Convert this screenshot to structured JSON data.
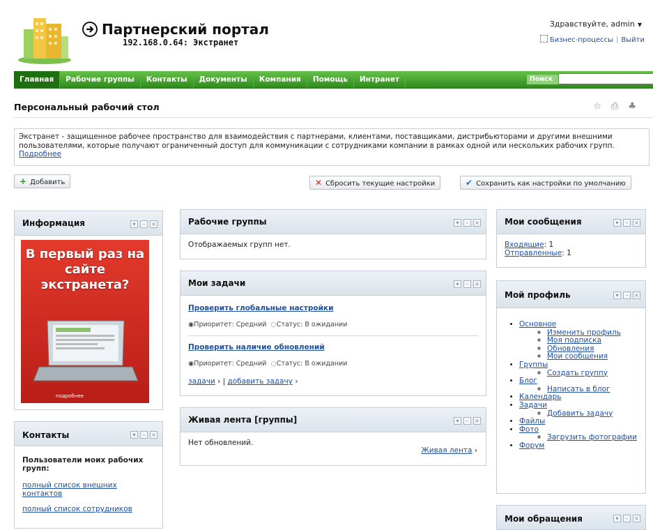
{
  "header": {
    "title": "Партнерский портал",
    "subtitle": "192.168.0.64: Экстранет",
    "greeting": "Здравствуйте, admin",
    "business_processes": "Бизнес-процессы",
    "logout": "Выйти"
  },
  "nav": {
    "items": [
      "Главная",
      "Рабочие группы",
      "Контакты",
      "Документы",
      "Компания",
      "Помощь",
      "Интранет"
    ],
    "search_label": "Поиск",
    "search_value": "",
    "search_btn": "x"
  },
  "page": {
    "title": "Персональный рабочий стол",
    "intro": "Экстранет - защищенное рабочее пространство для взаимодействия с партнерами, клиентами, поставщиками, дистрибьюторами и другими внешними пользователями, которые получают ограниченный доступ для коммуникации с сотрудниками компании в рамках одной или нескольких рабочих групп.",
    "intro_more": "Подробнее"
  },
  "toolbar": {
    "add": "Добавить",
    "reset": "Сбросить текущие настройки",
    "save_default": "Сохранить как настройки по умолчанию"
  },
  "colors": {
    "nav_green": "#2f8b1c",
    "link_blue": "#1f4fa0",
    "ad_red": "#d1261c"
  },
  "gadgets": {
    "info": {
      "title": "Информация",
      "ad_text": "В первый раз на сайте экстранета?",
      "ad_more": "подробнее"
    },
    "contacts": {
      "title": "Контакты",
      "subtitle": "Пользователи моих рабочих групп:",
      "link1": "полный список внешних контактов",
      "link2": "полный список сотрудников"
    },
    "workgroups": {
      "title": "Рабочие группы",
      "text": "Отображаемых групп нет."
    },
    "tasks": {
      "title": "Мои задачи",
      "items": [
        {
          "name": "Проверить глобальные настройки",
          "priority": "Приоритет: Средний",
          "status": "Статус: В ожидании"
        },
        {
          "name": "Проверить наличие обновлений",
          "priority": "Приоритет: Средний",
          "status": "Статус: В ожидании"
        }
      ],
      "link_tasks": "задачи",
      "link_add": "добавить задачу"
    },
    "livefeed": {
      "title": "Живая лента [группы]",
      "text": "Нет обновлений.",
      "link": "Живая лента"
    },
    "messages": {
      "title": "Мои сообщения",
      "inbox_label": "Входящие",
      "inbox_count": ": 1",
      "sent_label": "Отправленные",
      "sent_count": ": 1"
    },
    "profile": {
      "title": "Мой профиль",
      "basic": "Основное",
      "basic_sub": [
        "Изменить профиль",
        "Моя подписка",
        "Обновления",
        "Мои сообщения"
      ],
      "groups": "Группы",
      "groups_sub": [
        "Создать группу"
      ],
      "blog": "Блог",
      "blog_sub": [
        "Написать в блог"
      ],
      "calendar": "Календарь",
      "tasks": "Задачи",
      "tasks_sub": [
        "Добавить задачу"
      ],
      "files": "Файлы",
      "photo": "Фото",
      "photo_sub": [
        "Загрузить фотографии"
      ],
      "forum": "Форум"
    },
    "requests": {
      "title": "Мои обращения"
    }
  }
}
